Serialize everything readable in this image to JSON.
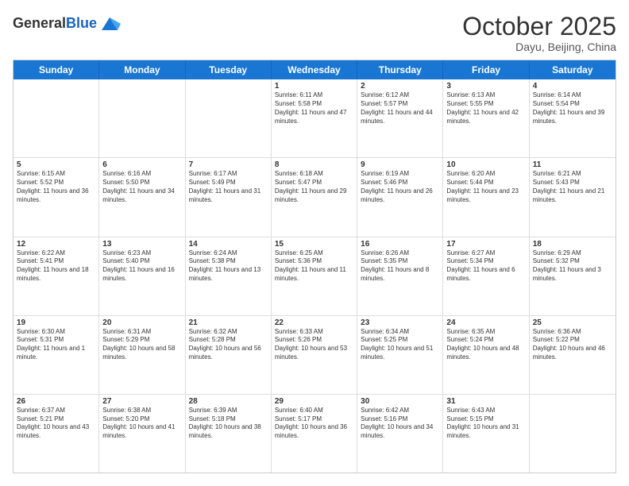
{
  "header": {
    "logo_general": "General",
    "logo_blue": "Blue",
    "month": "October 2025",
    "location": "Dayu, Beijing, China"
  },
  "weekdays": [
    "Sunday",
    "Monday",
    "Tuesday",
    "Wednesday",
    "Thursday",
    "Friday",
    "Saturday"
  ],
  "rows": [
    [
      {
        "day": "",
        "text": ""
      },
      {
        "day": "",
        "text": ""
      },
      {
        "day": "",
        "text": ""
      },
      {
        "day": "1",
        "text": "Sunrise: 6:11 AM\nSunset: 5:58 PM\nDaylight: 11 hours and 47 minutes."
      },
      {
        "day": "2",
        "text": "Sunrise: 6:12 AM\nSunset: 5:57 PM\nDaylight: 11 hours and 44 minutes."
      },
      {
        "day": "3",
        "text": "Sunrise: 6:13 AM\nSunset: 5:55 PM\nDaylight: 11 hours and 42 minutes."
      },
      {
        "day": "4",
        "text": "Sunrise: 6:14 AM\nSunset: 5:54 PM\nDaylight: 11 hours and 39 minutes."
      }
    ],
    [
      {
        "day": "5",
        "text": "Sunrise: 6:15 AM\nSunset: 5:52 PM\nDaylight: 11 hours and 36 minutes."
      },
      {
        "day": "6",
        "text": "Sunrise: 6:16 AM\nSunset: 5:50 PM\nDaylight: 11 hours and 34 minutes."
      },
      {
        "day": "7",
        "text": "Sunrise: 6:17 AM\nSunset: 5:49 PM\nDaylight: 11 hours and 31 minutes."
      },
      {
        "day": "8",
        "text": "Sunrise: 6:18 AM\nSunset: 5:47 PM\nDaylight: 11 hours and 29 minutes."
      },
      {
        "day": "9",
        "text": "Sunrise: 6:19 AM\nSunset: 5:46 PM\nDaylight: 11 hours and 26 minutes."
      },
      {
        "day": "10",
        "text": "Sunrise: 6:20 AM\nSunset: 5:44 PM\nDaylight: 11 hours and 23 minutes."
      },
      {
        "day": "11",
        "text": "Sunrise: 6:21 AM\nSunset: 5:43 PM\nDaylight: 11 hours and 21 minutes."
      }
    ],
    [
      {
        "day": "12",
        "text": "Sunrise: 6:22 AM\nSunset: 5:41 PM\nDaylight: 11 hours and 18 minutes."
      },
      {
        "day": "13",
        "text": "Sunrise: 6:23 AM\nSunset: 5:40 PM\nDaylight: 11 hours and 16 minutes."
      },
      {
        "day": "14",
        "text": "Sunrise: 6:24 AM\nSunset: 5:38 PM\nDaylight: 11 hours and 13 minutes."
      },
      {
        "day": "15",
        "text": "Sunrise: 6:25 AM\nSunset: 5:36 PM\nDaylight: 11 hours and 11 minutes."
      },
      {
        "day": "16",
        "text": "Sunrise: 6:26 AM\nSunset: 5:35 PM\nDaylight: 11 hours and 8 minutes."
      },
      {
        "day": "17",
        "text": "Sunrise: 6:27 AM\nSunset: 5:34 PM\nDaylight: 11 hours and 6 minutes."
      },
      {
        "day": "18",
        "text": "Sunrise: 6:29 AM\nSunset: 5:32 PM\nDaylight: 11 hours and 3 minutes."
      }
    ],
    [
      {
        "day": "19",
        "text": "Sunrise: 6:30 AM\nSunset: 5:31 PM\nDaylight: 11 hours and 1 minute."
      },
      {
        "day": "20",
        "text": "Sunrise: 6:31 AM\nSunset: 5:29 PM\nDaylight: 10 hours and 58 minutes."
      },
      {
        "day": "21",
        "text": "Sunrise: 6:32 AM\nSunset: 5:28 PM\nDaylight: 10 hours and 56 minutes."
      },
      {
        "day": "22",
        "text": "Sunrise: 6:33 AM\nSunset: 5:26 PM\nDaylight: 10 hours and 53 minutes."
      },
      {
        "day": "23",
        "text": "Sunrise: 6:34 AM\nSunset: 5:25 PM\nDaylight: 10 hours and 51 minutes."
      },
      {
        "day": "24",
        "text": "Sunrise: 6:35 AM\nSunset: 5:24 PM\nDaylight: 10 hours and 48 minutes."
      },
      {
        "day": "25",
        "text": "Sunrise: 6:36 AM\nSunset: 5:22 PM\nDaylight: 10 hours and 46 minutes."
      }
    ],
    [
      {
        "day": "26",
        "text": "Sunrise: 6:37 AM\nSunset: 5:21 PM\nDaylight: 10 hours and 43 minutes."
      },
      {
        "day": "27",
        "text": "Sunrise: 6:38 AM\nSunset: 5:20 PM\nDaylight: 10 hours and 41 minutes."
      },
      {
        "day": "28",
        "text": "Sunrise: 6:39 AM\nSunset: 5:18 PM\nDaylight: 10 hours and 38 minutes."
      },
      {
        "day": "29",
        "text": "Sunrise: 6:40 AM\nSunset: 5:17 PM\nDaylight: 10 hours and 36 minutes."
      },
      {
        "day": "30",
        "text": "Sunrise: 6:42 AM\nSunset: 5:16 PM\nDaylight: 10 hours and 34 minutes."
      },
      {
        "day": "31",
        "text": "Sunrise: 6:43 AM\nSunset: 5:15 PM\nDaylight: 10 hours and 31 minutes."
      },
      {
        "day": "",
        "text": ""
      }
    ]
  ]
}
